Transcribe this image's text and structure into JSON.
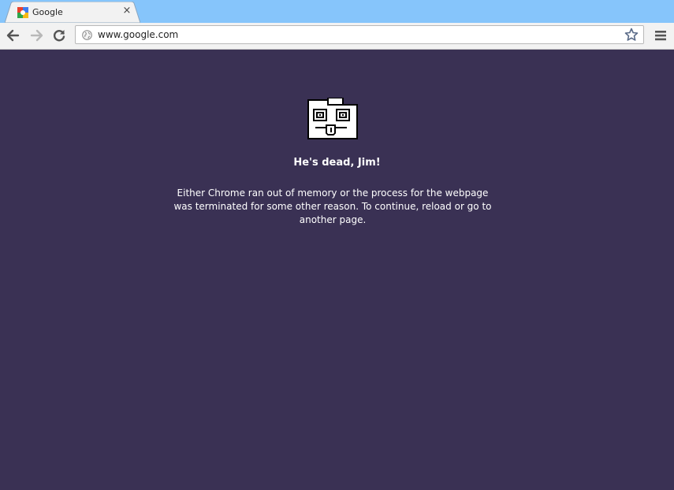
{
  "tab": {
    "title": "Google",
    "close_glyph": "×",
    "favicon": "google-favicon-icon"
  },
  "toolbar": {
    "back_icon": "back-arrow-icon",
    "forward_icon": "forward-arrow-icon",
    "reload_icon": "reload-icon",
    "bookmark_icon": "star-icon",
    "menu_icon": "hamburger-menu-icon"
  },
  "omnibox": {
    "url": "www.google.com",
    "page_icon": "globe-icon"
  },
  "crash_page": {
    "icon": "sad-tab-icon",
    "title": "He's dead, Jim!",
    "message": "Either Chrome ran out of memory or the process for the webpage was terminated for some other reason.  To continue, reload or go to another page."
  },
  "colors": {
    "tabstrip_bg": "#86c5fb",
    "toolbar_bg": "#f2f2f2",
    "crash_bg": "#3a3154",
    "text_on_crash": "#ffffff"
  }
}
